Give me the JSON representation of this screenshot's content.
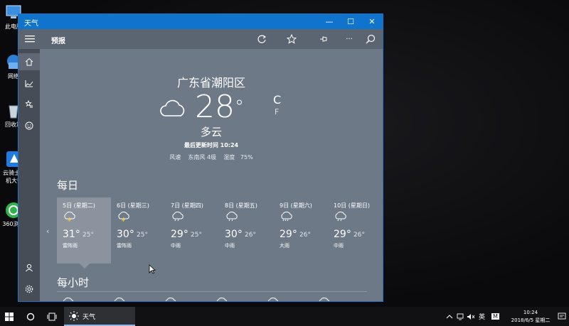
{
  "desktop": {
    "icons": [
      {
        "label": "此电脑",
        "icon": "computer-icon"
      },
      {
        "label": "网络",
        "icon": "network-icon"
      },
      {
        "label": "回收站",
        "icon": "recycle-bin-icon"
      },
      {
        "label": "云骑士装机大师",
        "icon": "yunqishi-icon"
      },
      {
        "label": "360浏览",
        "icon": "360-browser-icon"
      }
    ]
  },
  "window": {
    "title": "天气",
    "controls": {
      "minimize": "—",
      "maximize": "☐",
      "close": "✕"
    }
  },
  "topbar": {
    "section": "预报",
    "icons": [
      "refresh-icon",
      "favorite-star-icon",
      "pin-icon",
      "more-icon",
      "search-icon"
    ],
    "more_label": "···"
  },
  "sidebar": {
    "items": [
      "home-icon",
      "maps-icon",
      "historical-icon",
      "favorites-icon",
      "news-icon"
    ],
    "bottom": [
      "account-icon",
      "settings-icon"
    ]
  },
  "current": {
    "location": "广东省潮阳区",
    "temperature": "28",
    "degree": "°",
    "unit_c": "C",
    "unit_f": "F",
    "condition": "多云",
    "updated": "最后更新时间 10:24",
    "wind_label": "风速",
    "wind_value": "东南风 4级",
    "humidity_label": "湿度",
    "humidity_value": "75%"
  },
  "daily": {
    "title": "每日",
    "days": [
      {
        "date": "5日 (星期二)",
        "high": "31°",
        "low": "25°",
        "condition": "雷阵雨",
        "icon": "thunderstorm-icon",
        "selected": true
      },
      {
        "date": "6日 (星期三)",
        "high": "30°",
        "low": "25°",
        "condition": "雷阵雨",
        "icon": "thunderstorm-icon"
      },
      {
        "date": "7日 (星期四)",
        "high": "29°",
        "low": "25°",
        "condition": "中雨",
        "icon": "rain-icon"
      },
      {
        "date": "8日 (星期五)",
        "high": "30°",
        "low": "26°",
        "condition": "中雨",
        "icon": "rain-icon"
      },
      {
        "date": "9日 (星期六)",
        "high": "29°",
        "low": "26°",
        "condition": "大雨",
        "icon": "heavy-rain-icon"
      },
      {
        "date": "10日 (星期日)",
        "high": "29°",
        "low": "26°",
        "condition": "中雨",
        "icon": "rain-icon"
      }
    ],
    "prev": "‹",
    "next": "›"
  },
  "hourly": {
    "title": "每小时"
  },
  "taskbar": {
    "app_label": "天气",
    "ime": "英",
    "ime2": "M",
    "time": "10:24",
    "date": "2018/6/5 星期二"
  },
  "colors": {
    "titlebar": "#1174cc",
    "content_bg": "#6e7988",
    "sidebar_bg": "#464d57",
    "selected_card": "#8a939e"
  }
}
